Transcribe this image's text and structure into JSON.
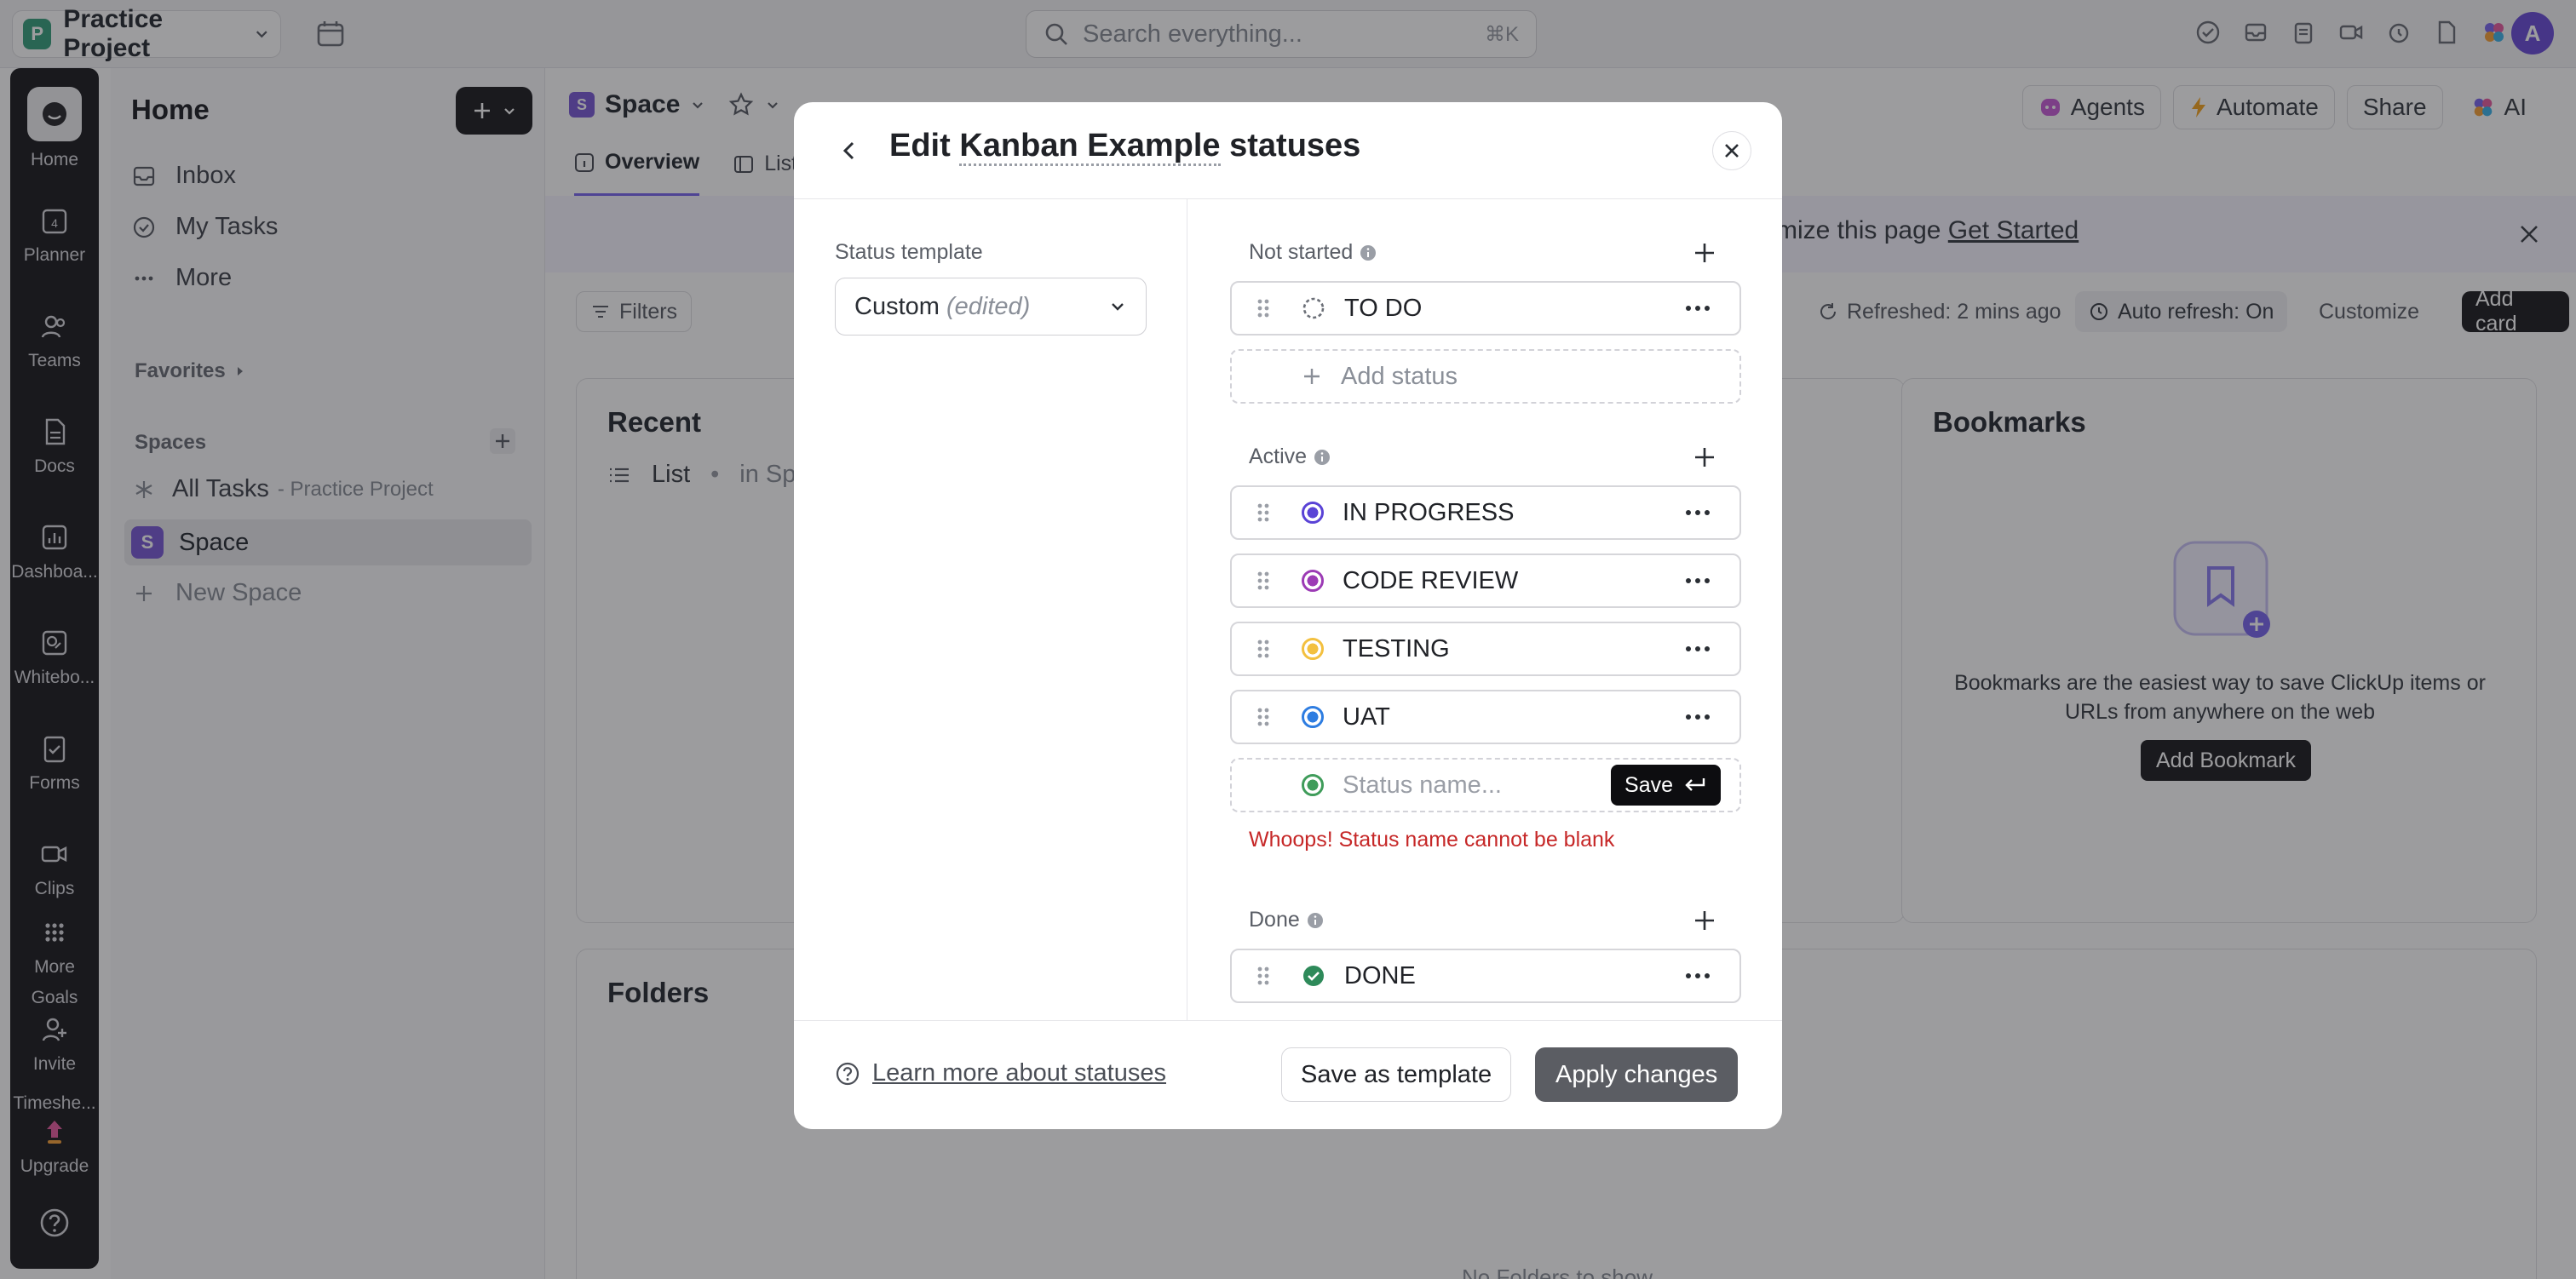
{
  "topbar": {
    "workspace_initial": "P",
    "workspace_name": "Practice Project",
    "search_placeholder": "Search everything...",
    "search_shortcut": "⌘K",
    "avatar_initial": "A"
  },
  "rail": {
    "items": [
      "Home",
      "Planner",
      "Teams",
      "Docs",
      "Dashboa...",
      "Whitebo...",
      "Forms",
      "Clips",
      "More",
      "Goals",
      "Invite",
      "Timeshe...",
      "Upgrade"
    ]
  },
  "sidebar": {
    "title": "Home",
    "inbox": "Inbox",
    "my_tasks": "My Tasks",
    "more": "More",
    "favorites": "Favorites",
    "spaces": "Spaces",
    "all_tasks": "All Tasks",
    "all_tasks_sub": "- Practice Project",
    "space_initial": "S",
    "space_name": "Space",
    "new_space": "New Space"
  },
  "main": {
    "crumb_initial": "S",
    "crumb": "Space",
    "tab_overview": "Overview",
    "tab_list": "List",
    "agents": "Agents",
    "automate": "Automate",
    "share": "Share",
    "ai": "AI",
    "banner_text": "mize this page",
    "banner_link": "Get Started",
    "filters": "Filters",
    "refreshed": "Refreshed: 2 mins ago",
    "auto_refresh": "Auto refresh: On",
    "customize": "Customize",
    "add_card": "Add card",
    "recent_title": "Recent",
    "recent_item": "List",
    "recent_item_sub": "in Spac",
    "bookmarks_title": "Bookmarks",
    "bookmarks_desc_1": "Bookmarks are the easiest way to save ClickUp items or",
    "bookmarks_desc_2": "URLs from anywhere on the web",
    "add_bookmark": "Add Bookmark",
    "folders_title": "Folders",
    "no_folders": "No Folders to show"
  },
  "modal": {
    "title_prefix": "Edit",
    "title_name": "Kanban Example",
    "title_suffix": "statuses",
    "template_label": "Status template",
    "template_value": "Custom",
    "template_edited": "(edited)",
    "groups": {
      "not_started": "Not started",
      "active": "Active",
      "done": "Done"
    },
    "add_status": "Add status",
    "status_placeholder": "Status name...",
    "save": "Save",
    "error": "Whoops! Status name cannot be blank",
    "learn_more": "Learn more about statuses",
    "save_template": "Save as template",
    "apply": "Apply changes",
    "statuses": [
      {
        "name": "TO DO",
        "color": "#8a8f98"
      },
      {
        "name": "IN PROGRESS",
        "color": "#5a43d6"
      },
      {
        "name": "CODE REVIEW",
        "color": "#9c3bb5"
      },
      {
        "name": "TESTING",
        "color": "#f3c03f"
      },
      {
        "name": "UAT",
        "color": "#2e7de1"
      },
      {
        "name": "DONE",
        "color": "#2e8a5a"
      }
    ],
    "new_status_color": "#3f9c5a"
  }
}
